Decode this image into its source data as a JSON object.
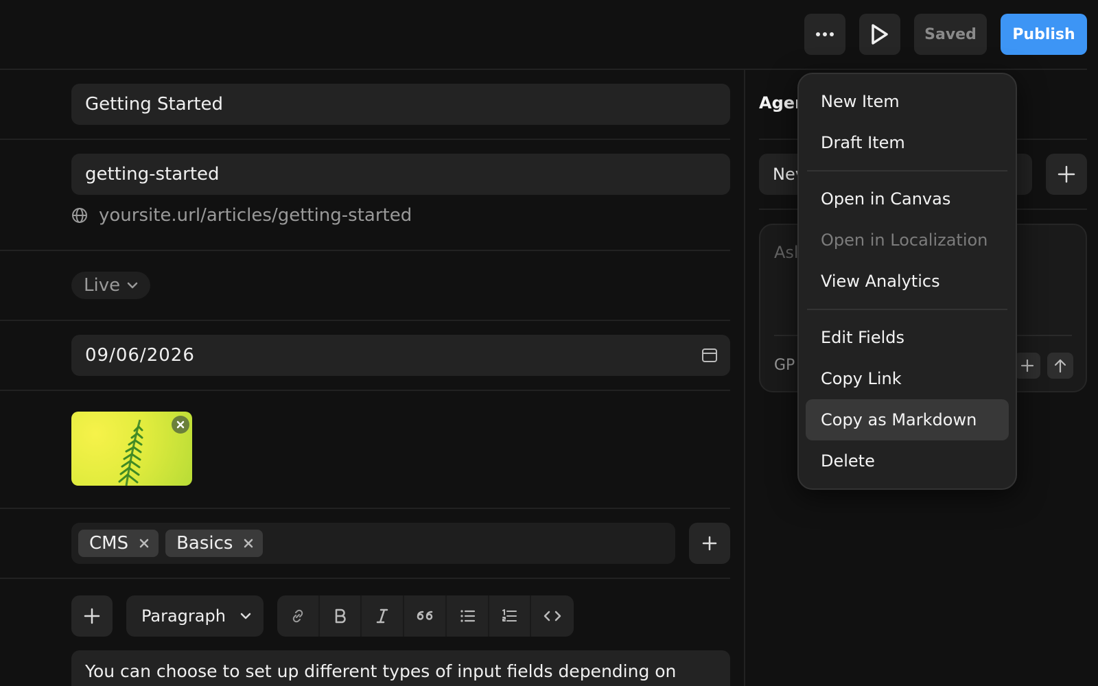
{
  "toolbar": {
    "more_icon": "more-horizontal-icon",
    "preview_icon": "play-icon",
    "saved_label": "Saved",
    "publish_label": "Publish"
  },
  "form": {
    "title_value": "Getting Started",
    "slug_value": "getting-started",
    "url_text": "yoursite.url/articles/getting-started",
    "status_value": "Live",
    "date_value": "09/06/2026",
    "tags": [
      {
        "label": "CMS"
      },
      {
        "label": "Basics"
      }
    ],
    "block_type": "Paragraph",
    "body_text": "You can choose to set up different types of input fields depending on"
  },
  "agent_panel": {
    "title": "Agen",
    "select_value": "Nev",
    "ask_placeholder": "Asl",
    "model_label": "GP"
  },
  "menu": {
    "groups": [
      [
        {
          "label": "New Item",
          "disabled": false
        },
        {
          "label": "Draft Item",
          "disabled": false
        }
      ],
      [
        {
          "label": "Open in Canvas",
          "disabled": false
        },
        {
          "label": "Open in Localization",
          "disabled": true
        },
        {
          "label": "View Analytics",
          "disabled": false
        }
      ],
      [
        {
          "label": "Edit Fields",
          "disabled": false
        },
        {
          "label": "Copy Link",
          "disabled": false
        },
        {
          "label": "Copy as Markdown",
          "disabled": false,
          "highlighted": true
        },
        {
          "label": "Delete",
          "disabled": false
        }
      ]
    ]
  },
  "colors": {
    "background": "#111111",
    "accent": "#3d95f5",
    "field": "#232323",
    "menu": "#222222"
  }
}
